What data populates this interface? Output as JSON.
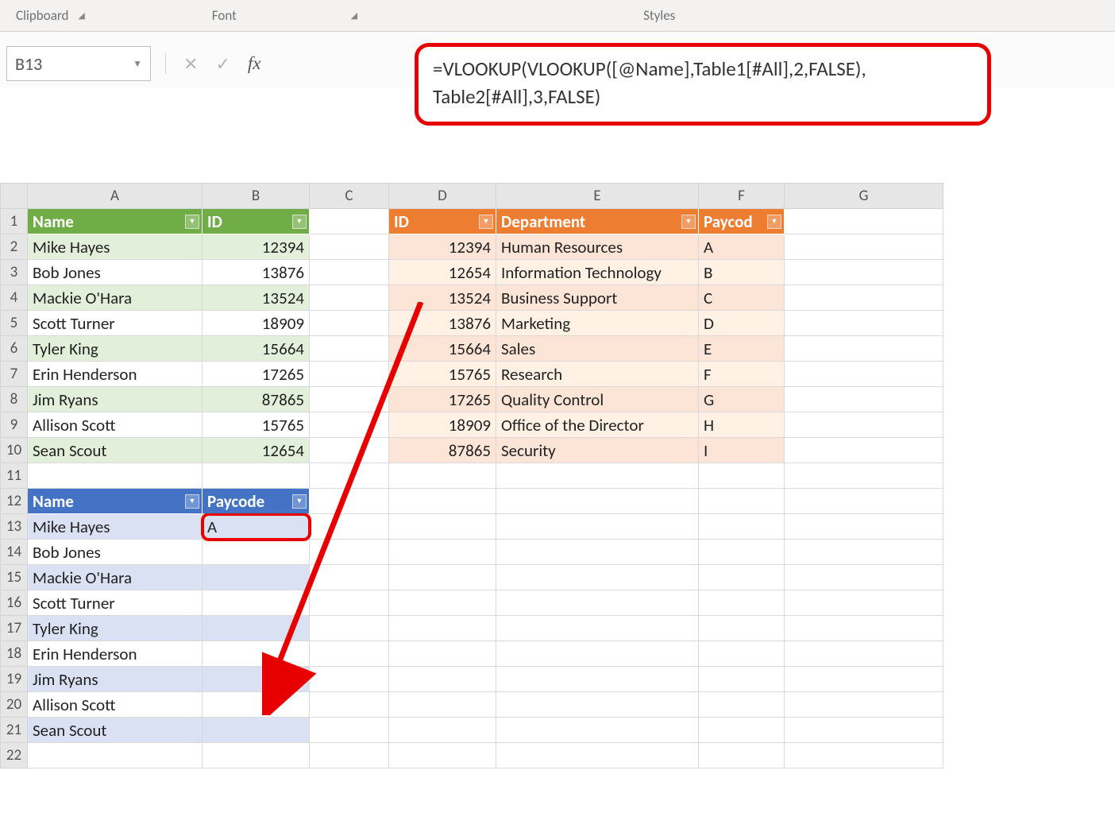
{
  "ribbon": {
    "clipboard": "Clipboard",
    "font": "Font",
    "styles": "Styles"
  },
  "nameBox": "B13",
  "fxLabel": "fx",
  "formulaLines": [
    "=VLOOKUP(VLOOKUP([@Name],Table1[#All],2,FALSE),",
    "Table2[#All],3,FALSE)"
  ],
  "columns": [
    "A",
    "B",
    "C",
    "D",
    "E",
    "F",
    "G"
  ],
  "rowCount": 22,
  "table1": {
    "headers": [
      "Name",
      "ID"
    ],
    "rows": [
      {
        "name": "Mike Hayes",
        "id": "12394"
      },
      {
        "name": "Bob Jones",
        "id": "13876"
      },
      {
        "name": "Mackie O'Hara",
        "id": "13524"
      },
      {
        "name": "Scott Turner",
        "id": "18909"
      },
      {
        "name": "Tyler King",
        "id": "15664"
      },
      {
        "name": "Erin Henderson",
        "id": "17265"
      },
      {
        "name": "Jim Ryans",
        "id": "87865"
      },
      {
        "name": "Allison Scott",
        "id": "15765"
      },
      {
        "name": "Sean Scout",
        "id": "12654"
      }
    ]
  },
  "table2": {
    "headers": [
      "ID",
      "Department",
      "Paycode"
    ],
    "headerShort": "Paycod",
    "rows": [
      {
        "id": "12394",
        "dept": "Human Resources",
        "pc": "A"
      },
      {
        "id": "12654",
        "dept": "Information Technology",
        "pc": "B"
      },
      {
        "id": "13524",
        "dept": "Business Support",
        "pc": "C"
      },
      {
        "id": "13876",
        "dept": "Marketing",
        "pc": "D"
      },
      {
        "id": "15664",
        "dept": "Sales",
        "pc": "E"
      },
      {
        "id": "15765",
        "dept": "Research",
        "pc": "F"
      },
      {
        "id": "17265",
        "dept": "Quality Control",
        "pc": "G"
      },
      {
        "id": "18909",
        "dept": "Office of the Director",
        "pc": "H"
      },
      {
        "id": "87865",
        "dept": "Security",
        "pc": "I"
      }
    ]
  },
  "table3": {
    "headers": [
      "Name",
      "Paycode"
    ],
    "headerShort": "Paycode",
    "rows": [
      {
        "name": "Mike Hayes",
        "pc": "A"
      },
      {
        "name": "Bob Jones",
        "pc": ""
      },
      {
        "name": "Mackie O'Hara",
        "pc": ""
      },
      {
        "name": "Scott Turner",
        "pc": ""
      },
      {
        "name": "Tyler King",
        "pc": ""
      },
      {
        "name": "Erin Henderson",
        "pc": ""
      },
      {
        "name": "Jim Ryans",
        "pc": ""
      },
      {
        "name": "Allison Scott",
        "pc": ""
      },
      {
        "name": "Sean Scout",
        "pc": ""
      }
    ]
  },
  "colWidths": {
    "rh": 34,
    "A": 220,
    "B": 135,
    "C": 100,
    "D": 135,
    "E": 255,
    "F": 108,
    "G": 200
  }
}
